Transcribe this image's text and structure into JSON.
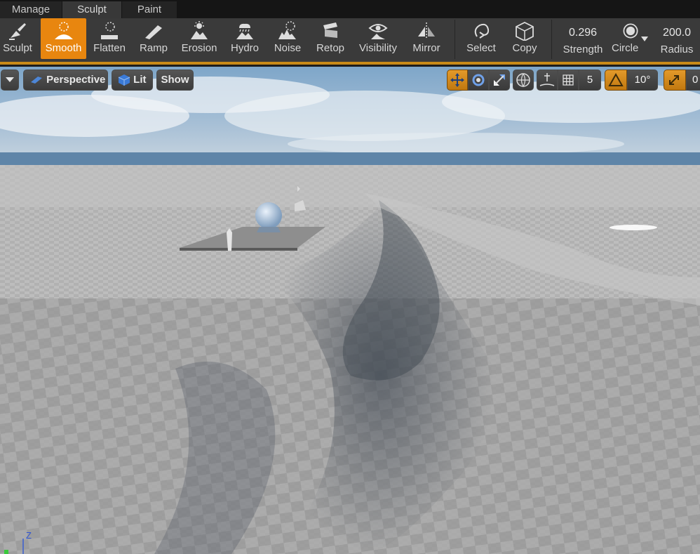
{
  "mode_tabs": [
    {
      "label": "Manage",
      "active": false
    },
    {
      "label": "Sculpt",
      "active": true
    },
    {
      "label": "Paint",
      "active": false
    }
  ],
  "tools": [
    {
      "label": "Sculpt",
      "icon": "sculpt-icon",
      "active": false
    },
    {
      "label": "Smooth",
      "icon": "smooth-icon",
      "active": true
    },
    {
      "label": "Flatten",
      "icon": "flatten-icon",
      "active": false
    },
    {
      "label": "Ramp",
      "icon": "ramp-icon",
      "active": false
    },
    {
      "label": "Erosion",
      "icon": "erosion-icon",
      "active": false
    },
    {
      "label": "Hydro",
      "icon": "hydro-icon",
      "active": false
    },
    {
      "label": "Noise",
      "icon": "noise-icon",
      "active": false
    },
    {
      "label": "Retop",
      "icon": "retop-icon",
      "active": false
    },
    {
      "label": "Visibility",
      "icon": "visibility-icon",
      "active": false
    },
    {
      "label": "Mirror",
      "icon": "mirror-icon",
      "active": false
    }
  ],
  "selection_tools": [
    {
      "label": "Select",
      "icon": "select-icon"
    },
    {
      "label": "Copy",
      "icon": "copy-icon"
    }
  ],
  "brush": {
    "strength_value": "0.296",
    "strength_label": "Strength",
    "shape_label": "Circle",
    "radius_value": "200.0",
    "radius_label": "Radius"
  },
  "viewport_toolbar": {
    "perspective_label": "Perspective",
    "lit_label": "Lit",
    "show_label": "Show",
    "grid_snap_value": "5",
    "rotation_snap_value": "10°",
    "scale_snap_value": "0"
  },
  "axis_label": "Z",
  "colors": {
    "accent": "#e8860f",
    "toolbar_bg": "#3a3a3a",
    "tab_bar_bg": "#151515"
  }
}
